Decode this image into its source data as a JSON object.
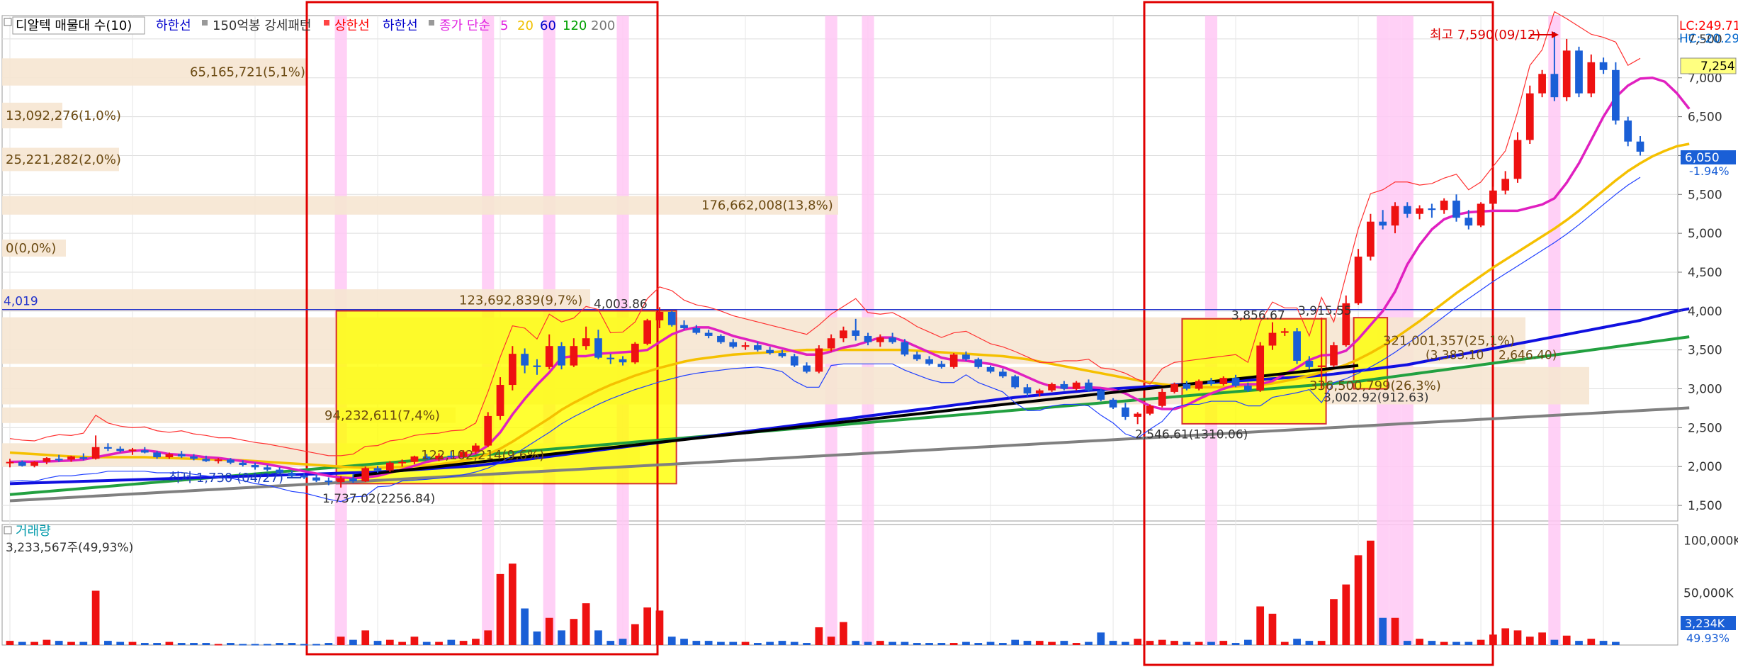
{
  "header": {
    "title": "디알텍 매물대 수(10)",
    "items": [
      {
        "label": "하한선",
        "color": "#0000cc"
      },
      {
        "label": "150억봉 강세패턴",
        "color": "#333333"
      },
      {
        "label": "상한선",
        "color": "#ff0000"
      },
      {
        "label": "하한선",
        "color": "#0000cc"
      }
    ],
    "ma_title": "종가 단순",
    "ma_periods": [
      {
        "label": "5",
        "color": "#e020e0"
      },
      {
        "label": "20",
        "color": "#f0c000"
      },
      {
        "label": "60",
        "color": "#0000cc"
      },
      {
        "label": "120",
        "color": "#00a000"
      },
      {
        "label": "200",
        "color": "#777777"
      }
    ],
    "lc_label": "LC:249.71",
    "hc_label": "HC:-20.29"
  },
  "price_axis": {
    "ticks": [
      "7,500",
      "7,000",
      "6,500",
      "6,000",
      "5,500",
      "5,000",
      "4,500",
      "4,000",
      "3,500",
      "3,000",
      "2,500",
      "2,000",
      "1,500"
    ],
    "high_box": "7,254",
    "current_box": "6,050",
    "current_change": "-1.94%"
  },
  "volume_axis": {
    "ticks": [
      "100,000K",
      "50,000K"
    ],
    "current_box": "3,234K",
    "current_pct": "49.93%"
  },
  "volume_panel": {
    "title": "거래량",
    "value": "3,233,567주(49,93%)"
  },
  "annotations": {
    "high": "최고 7,590(09/12)",
    "low": "최저 1,730 (04/27)",
    "level_4019": "4,019",
    "p4003": "4,003.86",
    "p3856": "3,856.67",
    "p3915": "3,915.55",
    "p1737": "1,737.02(2256.84)",
    "p2546": "2,546.61(1310.06)",
    "p3002": "3,002.92(912.63)",
    "p3383": "(3,383.10",
    "p2646": "2,646.40)"
  },
  "chart_data": {
    "type": "candlestick",
    "price_range": [
      1300,
      7800
    ],
    "volume_range": [
      0,
      110000000
    ],
    "volume_profile": [
      {
        "label": "65,165,721(5,1%)",
        "low": 6900,
        "high": 7250
      },
      {
        "label": "13,092,276(1,0%)",
        "low": 6350,
        "high": 6680
      },
      {
        "label": "25,221,282(2,0%)",
        "low": 5800,
        "high": 6100
      },
      {
        "label": "176,662,008(13,8%)",
        "low": 5240,
        "high": 5480
      },
      {
        "label": "0(0,0%)",
        "low": 4700,
        "high": 4920
      },
      {
        "label": "123,692,839(9,7%)",
        "low": 4000,
        "high": 4280
      },
      {
        "label": "321,001,357(25,1%)",
        "low": 3320,
        "high": 3920
      },
      {
        "label": "336,500,799(26,3%)",
        "low": 2800,
        "high": 3280
      },
      {
        "label": "94,232,611(7,4%)",
        "low": 2560,
        "high": 2760
      },
      {
        "label": "122,102,214(9,6%)",
        "low": 2000,
        "high": 2300
      }
    ],
    "candles": [
      [
        2050,
        2100,
        1990,
        2060
      ],
      [
        2060,
        2080,
        2000,
        2010
      ],
      [
        2010,
        2070,
        1990,
        2060
      ],
      [
        2060,
        2120,
        2030,
        2110
      ],
      [
        2100,
        2150,
        2060,
        2080
      ],
      [
        2090,
        2140,
        2060,
        2130
      ],
      [
        2120,
        2170,
        2080,
        2100
      ],
      [
        2100,
        2400,
        2090,
        2250
      ],
      [
        2250,
        2300,
        2200,
        2230
      ],
      [
        2230,
        2260,
        2180,
        2200
      ],
      [
        2200,
        2240,
        2150,
        2220
      ],
      [
        2210,
        2250,
        2170,
        2180
      ],
      [
        2180,
        2200,
        2100,
        2120
      ],
      [
        2120,
        2180,
        2100,
        2160
      ],
      [
        2160,
        2200,
        2110,
        2130
      ],
      [
        2130,
        2160,
        2080,
        2100
      ],
      [
        2100,
        2140,
        2060,
        2070
      ],
      [
        2070,
        2110,
        2040,
        2090
      ],
      [
        2090,
        2110,
        2030,
        2050
      ],
      [
        2050,
        2080,
        2000,
        2020
      ],
      [
        2020,
        2050,
        1960,
        1990
      ],
      [
        1990,
        2020,
        1940,
        1960
      ],
      [
        1960,
        1990,
        1900,
        1920
      ],
      [
        1920,
        1950,
        1860,
        1880
      ],
      [
        1880,
        1920,
        1840,
        1860
      ],
      [
        1860,
        1900,
        1800,
        1820
      ],
      [
        1820,
        1860,
        1760,
        1800
      ],
      [
        1800,
        1880,
        1730,
        1850
      ],
      [
        1850,
        1900,
        1790,
        1810
      ],
      [
        1810,
        2000,
        1800,
        1980
      ],
      [
        1980,
        2010,
        1920,
        1950
      ],
      [
        1950,
        2070,
        1930,
        2050
      ],
      [
        2050,
        2090,
        2000,
        2060
      ],
      [
        2060,
        2140,
        2030,
        2130
      ],
      [
        2130,
        2160,
        2080,
        2090
      ],
      [
        2090,
        2170,
        2070,
        2140
      ],
      [
        2140,
        2200,
        2100,
        2120
      ],
      [
        2120,
        2210,
        2100,
        2190
      ],
      [
        2190,
        2300,
        2160,
        2270
      ],
      [
        2270,
        2700,
        2250,
        2650
      ],
      [
        2650,
        3150,
        2600,
        3050
      ],
      [
        3050,
        3550,
        2980,
        3450
      ],
      [
        3450,
        3520,
        3200,
        3300
      ],
      [
        3300,
        3380,
        3180,
        3280
      ],
      [
        3280,
        3700,
        3250,
        3550
      ],
      [
        3550,
        3600,
        3250,
        3300
      ],
      [
        3300,
        3650,
        3280,
        3550
      ],
      [
        3550,
        3800,
        3500,
        3650
      ],
      [
        3650,
        3760,
        3380,
        3400
      ],
      [
        3400,
        3450,
        3320,
        3380
      ],
      [
        3380,
        3420,
        3300,
        3340
      ],
      [
        3340,
        3600,
        3320,
        3580
      ],
      [
        3580,
        3900,
        3560,
        3880
      ],
      [
        3880,
        4050,
        3780,
        3990
      ],
      [
        3990,
        4003,
        3800,
        3820
      ],
      [
        3820,
        3880,
        3760,
        3780
      ],
      [
        3780,
        3820,
        3700,
        3720
      ],
      [
        3720,
        3760,
        3650,
        3680
      ],
      [
        3680,
        3700,
        3580,
        3600
      ],
      [
        3600,
        3640,
        3520,
        3540
      ],
      [
        3540,
        3600,
        3500,
        3560
      ],
      [
        3560,
        3600,
        3480,
        3500
      ],
      [
        3500,
        3540,
        3440,
        3460
      ],
      [
        3460,
        3500,
        3400,
        3420
      ],
      [
        3420,
        3450,
        3280,
        3300
      ],
      [
        3300,
        3340,
        3200,
        3220
      ],
      [
        3220,
        3560,
        3200,
        3520
      ],
      [
        3520,
        3700,
        3480,
        3650
      ],
      [
        3650,
        3800,
        3600,
        3750
      ],
      [
        3750,
        3900,
        3620,
        3680
      ],
      [
        3680,
        3720,
        3560,
        3600
      ],
      [
        3600,
        3700,
        3540,
        3660
      ],
      [
        3660,
        3720,
        3580,
        3600
      ],
      [
        3600,
        3640,
        3420,
        3440
      ],
      [
        3440,
        3480,
        3360,
        3380
      ],
      [
        3380,
        3420,
        3300,
        3320
      ],
      [
        3320,
        3360,
        3260,
        3280
      ],
      [
        3280,
        3460,
        3260,
        3440
      ],
      [
        3440,
        3480,
        3360,
        3380
      ],
      [
        3380,
        3400,
        3260,
        3280
      ],
      [
        3280,
        3300,
        3200,
        3220
      ],
      [
        3220,
        3260,
        3140,
        3160
      ],
      [
        3160,
        3180,
        3000,
        3020
      ],
      [
        3020,
        3060,
        2900,
        2940
      ],
      [
        2940,
        3000,
        2900,
        2980
      ],
      [
        2980,
        3080,
        2960,
        3060
      ],
      [
        3060,
        3100,
        2980,
        3000
      ],
      [
        3000,
        3100,
        2980,
        3080
      ],
      [
        3080,
        3120,
        2960,
        2980
      ],
      [
        2980,
        3000,
        2840,
        2860
      ],
      [
        2860,
        2880,
        2740,
        2760
      ],
      [
        2760,
        2820,
        2600,
        2640
      ],
      [
        2640,
        2700,
        2546,
        2680
      ],
      [
        2680,
        2800,
        2660,
        2780
      ],
      [
        2780,
        3000,
        2760,
        2960
      ],
      [
        2960,
        3080,
        2940,
        3060
      ],
      [
        3060,
        3100,
        2980,
        3000
      ],
      [
        3000,
        3120,
        2980,
        3100
      ],
      [
        3100,
        3140,
        3040,
        3060
      ],
      [
        3060,
        3160,
        3040,
        3140
      ],
      [
        3140,
        3180,
        3020,
        3040
      ],
      [
        3040,
        3080,
        2960,
        2980
      ],
      [
        2980,
        3600,
        2960,
        3556
      ],
      [
        3556,
        3856,
        3500,
        3720
      ],
      [
        3720,
        3780,
        3680,
        3740
      ],
      [
        3740,
        3780,
        3320,
        3360
      ],
      [
        3360,
        3420,
        3250,
        3280
      ],
      [
        3280,
        3915,
        3002,
        3300
      ],
      [
        3300,
        3600,
        3280,
        3560
      ],
      [
        3560,
        4200,
        3540,
        4100
      ],
      [
        4100,
        4800,
        4080,
        4700
      ],
      [
        4700,
        5250,
        4650,
        5150
      ],
      [
        5150,
        5300,
        5050,
        5100
      ],
      [
        5100,
        5400,
        5000,
        5350
      ],
      [
        5350,
        5400,
        5200,
        5250
      ],
      [
        5250,
        5360,
        5180,
        5320
      ],
      [
        5320,
        5380,
        5200,
        5300
      ],
      [
        5300,
        5450,
        5250,
        5420
      ],
      [
        5420,
        5500,
        5150,
        5200
      ],
      [
        5200,
        5300,
        5050,
        5100
      ],
      [
        5100,
        5400,
        5080,
        5380
      ],
      [
        5380,
        5600,
        5350,
        5550
      ],
      [
        5550,
        5800,
        5500,
        5700
      ],
      [
        5700,
        6300,
        5650,
        6200
      ],
      [
        6200,
        6900,
        6150,
        6800
      ],
      [
        6800,
        7100,
        6750,
        7050
      ],
      [
        7050,
        7590,
        6700,
        6750
      ],
      [
        6750,
        7500,
        6700,
        7350
      ],
      [
        7350,
        7400,
        6750,
        6800
      ],
      [
        6800,
        7300,
        6750,
        7200
      ],
      [
        7200,
        7260,
        7050,
        7100
      ],
      [
        7100,
        7200,
        6400,
        6450
      ],
      [
        6450,
        6500,
        6120,
        6180
      ],
      [
        6180,
        6250,
        6000,
        6050
      ]
    ],
    "volumes": [
      4,
      3,
      3,
      5,
      4,
      3,
      3,
      52,
      4,
      3,
      3,
      2,
      2,
      3,
      2,
      2,
      2,
      1,
      2,
      1,
      1,
      1,
      2,
      2,
      1,
      1,
      2,
      8,
      5,
      14,
      4,
      5,
      3,
      8,
      3,
      3,
      5,
      4,
      6,
      14,
      68,
      78,
      35,
      13,
      26,
      14,
      25,
      40,
      14,
      4,
      6,
      20,
      36,
      33,
      8,
      6,
      4,
      4,
      3,
      3,
      3,
      2,
      3,
      4,
      3,
      2,
      17,
      8,
      22,
      4,
      3,
      4,
      3,
      3,
      2,
      2,
      2,
      2,
      3,
      2,
      3,
      2,
      5,
      4,
      4,
      3,
      4,
      2,
      3,
      12,
      4,
      3,
      6,
      4,
      5,
      4,
      3,
      3,
      3,
      4,
      2,
      5,
      37,
      30,
      3,
      6,
      4,
      4,
      44,
      58,
      86,
      100,
      26,
      26,
      4,
      6,
      4,
      3,
      3,
      3,
      5,
      10,
      16,
      14,
      8,
      12,
      5,
      9,
      4,
      6,
      4,
      3
    ],
    "ma5": [
      2060,
      2064,
      2062,
      2066,
      2072,
      2078,
      2090,
      2120,
      2150,
      2180,
      2200,
      2210,
      2190,
      2160,
      2150,
      2140,
      2120,
      2110,
      2090,
      2070,
      2050,
      2030,
      2000,
      1970,
      1940,
      1910,
      1880,
      1860,
      1850,
      1860,
      1880,
      1920,
      1960,
      2010,
      2060,
      2090,
      2110,
      2130,
      2170,
      2270,
      2440,
      2670,
      2870,
      3050,
      3210,
      3400,
      3420,
      3420,
      3450,
      3460,
      3470,
      3480,
      3500,
      3600,
      3700,
      3760,
      3790,
      3790,
      3740,
      3680,
      3640,
      3600,
      3560,
      3520,
      3480,
      3440,
      3440,
      3480,
      3530,
      3560,
      3610,
      3660,
      3660,
      3610,
      3540,
      3470,
      3400,
      3370,
      3360,
      3340,
      3320,
      3280,
      3220,
      3150,
      3080,
      3030,
      3010,
      3010,
      3020,
      3010,
      2990,
      2940,
      2860,
      2780,
      2740,
      2740,
      2790,
      2870,
      2940,
      3000,
      3050,
      3060,
      3060,
      3100,
      3190,
      3270,
      3370,
      3430,
      3440,
      3490,
      3640,
      3820,
      4000,
      4250,
      4600,
      4850,
      5050,
      5180,
      5240,
      5270,
      5280,
      5290,
      5290,
      5290,
      5330,
      5370,
      5450,
      5650,
      5900,
      6200,
      6500,
      6750,
      6900,
      6990,
      7000,
      6950,
      6800,
      6600
    ],
    "ma20": [
      2180,
      2170,
      2160,
      2150,
      2140,
      2130,
      2125,
      2120,
      2120,
      2120,
      2120,
      2120,
      2115,
      2110,
      2105,
      2100,
      2095,
      2090,
      2085,
      2080,
      2070,
      2060,
      2050,
      2040,
      2030,
      2020,
      2010,
      2000,
      1990,
      1985,
      1985,
      1990,
      1995,
      2005,
      2015,
      2030,
      2050,
      2075,
      2110,
      2160,
      2230,
      2320,
      2420,
      2520,
      2620,
      2730,
      2820,
      2900,
      2980,
      3050,
      3110,
      3170,
      3220,
      3270,
      3310,
      3350,
      3380,
      3400,
      3420,
      3440,
      3450,
      3460,
      3470,
      3480,
      3490,
      3500,
      3500,
      3500,
      3500,
      3500,
      3500,
      3500,
      3500,
      3500,
      3490,
      3480,
      3470,
      3460,
      3450,
      3440,
      3430,
      3420,
      3400,
      3380,
      3350,
      3320,
      3290,
      3260,
      3230,
      3200,
      3170,
      3140,
      3110,
      3080,
      3060,
      3040,
      3030,
      3020,
      3020,
      3020,
      3030,
      3040,
      3050,
      3070,
      3100,
      3130,
      3170,
      3210,
      3260,
      3310,
      3380,
      3460,
      3550,
      3650,
      3760,
      3870,
      3990,
      4110,
      4230,
      4340,
      4450,
      4560,
      4660,
      4760,
      4860,
      4960,
      5060,
      5170,
      5290,
      5420,
      5550,
      5680,
      5800,
      5900,
      5990,
      6060,
      6120,
      6150
    ],
    "ma60": [
      1780,
      1785,
      1790,
      1795,
      1800,
      1805,
      1810,
      1815,
      1820,
      1825,
      1830,
      1835,
      1840,
      1845,
      1850,
      1855,
      1860,
      1865,
      1870,
      1875,
      1880,
      1885,
      1890,
      1895,
      1900,
      1905,
      1910,
      1915,
      1920,
      1925,
      1930,
      1940,
      1950,
      1960,
      1970,
      1980,
      1990,
      2000,
      2010,
      2030,
      2050,
      2070,
      2090,
      2110,
      2130,
      2150,
      2170,
      2190,
      2210,
      2230,
      2250,
      2270,
      2290,
      2310,
      2330,
      2350,
      2370,
      2390,
      2410,
      2430,
      2450,
      2470,
      2490,
      2510,
      2530,
      2550,
      2570,
      2590,
      2610,
      2630,
      2650,
      2670,
      2690,
      2710,
      2730,
      2750,
      2770,
      2790,
      2810,
      2830,
      2850,
      2870,
      2890,
      2905,
      2920,
      2935,
      2950,
      2965,
      2980,
      2990,
      3000,
      3010,
      3020,
      3030,
      3040,
      3050,
      3060,
      3070,
      3080,
      3090,
      3100,
      3110,
      3120,
      3130,
      3140,
      3150,
      3160,
      3175,
      3190,
      3210,
      3230,
      3250,
      3270,
      3290,
      3310,
      3340,
      3370,
      3400,
      3430,
      3460,
      3490,
      3520,
      3550,
      3580,
      3610,
      3640,
      3670,
      3700,
      3730,
      3760,
      3790,
      3820,
      3850,
      3880,
      3920,
      3960,
      4000,
      4030
    ]
  }
}
